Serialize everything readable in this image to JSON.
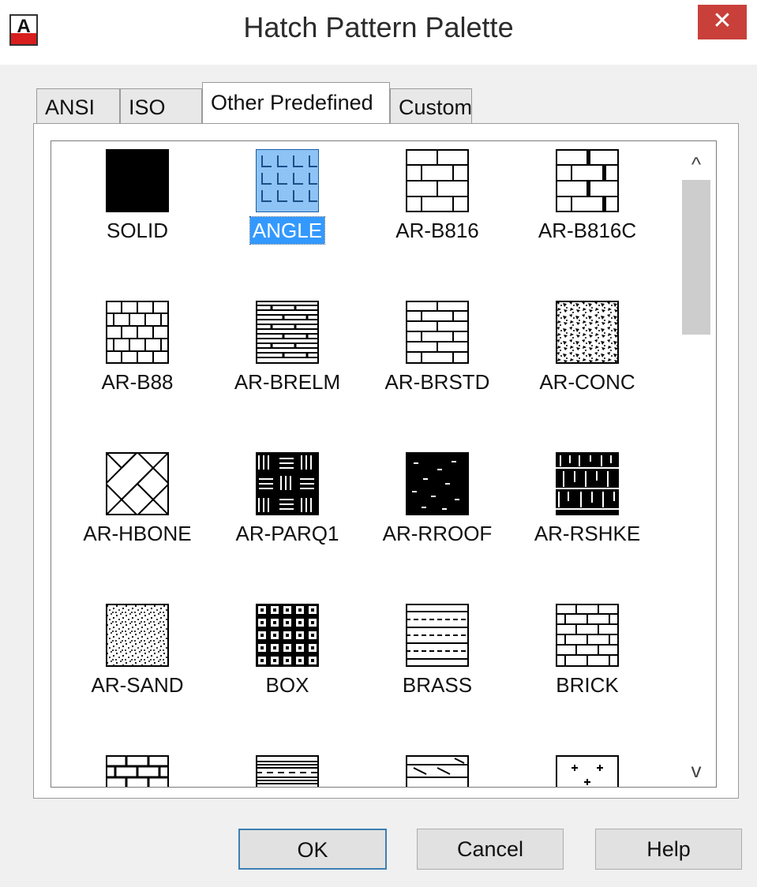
{
  "window": {
    "title": "Hatch Pattern Palette",
    "close_glyph": "✕",
    "app_icon": "autocad-app-icon"
  },
  "tabs": [
    {
      "label": "ANSI",
      "active": false
    },
    {
      "label": "ISO",
      "active": false
    },
    {
      "label": "Other Predefined",
      "active": true
    },
    {
      "label": "Custom",
      "active": false
    }
  ],
  "patterns": [
    {
      "label": "SOLID",
      "icon": "solid-pattern-icon",
      "selected": false
    },
    {
      "label": "ANGLE",
      "icon": "angle-pattern-icon",
      "selected": true
    },
    {
      "label": "AR-B816",
      "icon": "ar-b816-pattern-icon",
      "selected": false
    },
    {
      "label": "AR-B816C",
      "icon": "ar-b816c-pattern-icon",
      "selected": false
    },
    {
      "label": "AR-B88",
      "icon": "ar-b88-pattern-icon",
      "selected": false
    },
    {
      "label": "AR-BRELM",
      "icon": "ar-brelm-pattern-icon",
      "selected": false
    },
    {
      "label": "AR-BRSTD",
      "icon": "ar-brstd-pattern-icon",
      "selected": false
    },
    {
      "label": "AR-CONC",
      "icon": "ar-conc-pattern-icon",
      "selected": false
    },
    {
      "label": "AR-HBONE",
      "icon": "ar-hbone-pattern-icon",
      "selected": false
    },
    {
      "label": "AR-PARQ1",
      "icon": "ar-parq1-pattern-icon",
      "selected": false
    },
    {
      "label": "AR-RROOF",
      "icon": "ar-rroof-pattern-icon",
      "selected": false
    },
    {
      "label": "AR-RSHKE",
      "icon": "ar-rshke-pattern-icon",
      "selected": false
    },
    {
      "label": "AR-SAND",
      "icon": "ar-sand-pattern-icon",
      "selected": false
    },
    {
      "label": "BOX",
      "icon": "box-pattern-icon",
      "selected": false
    },
    {
      "label": "BRASS",
      "icon": "brass-pattern-icon",
      "selected": false
    },
    {
      "label": "BRICK",
      "icon": "brick-pattern-icon",
      "selected": false
    },
    {
      "label": "",
      "icon": "brstone-pattern-icon",
      "selected": false
    },
    {
      "label": "",
      "icon": "clay-pattern-icon",
      "selected": false
    },
    {
      "label": "",
      "icon": "cork-pattern-icon",
      "selected": false
    },
    {
      "label": "",
      "icon": "cross-pattern-icon",
      "selected": false
    }
  ],
  "scrollbar": {
    "up_glyph": "^",
    "down_glyph": "v"
  },
  "buttons": {
    "ok": "OK",
    "cancel": "Cancel",
    "help": "Help"
  },
  "colors": {
    "selection": "#3399ff",
    "close_button": "#c9403a",
    "angle_fill": "#8ec3f5"
  }
}
